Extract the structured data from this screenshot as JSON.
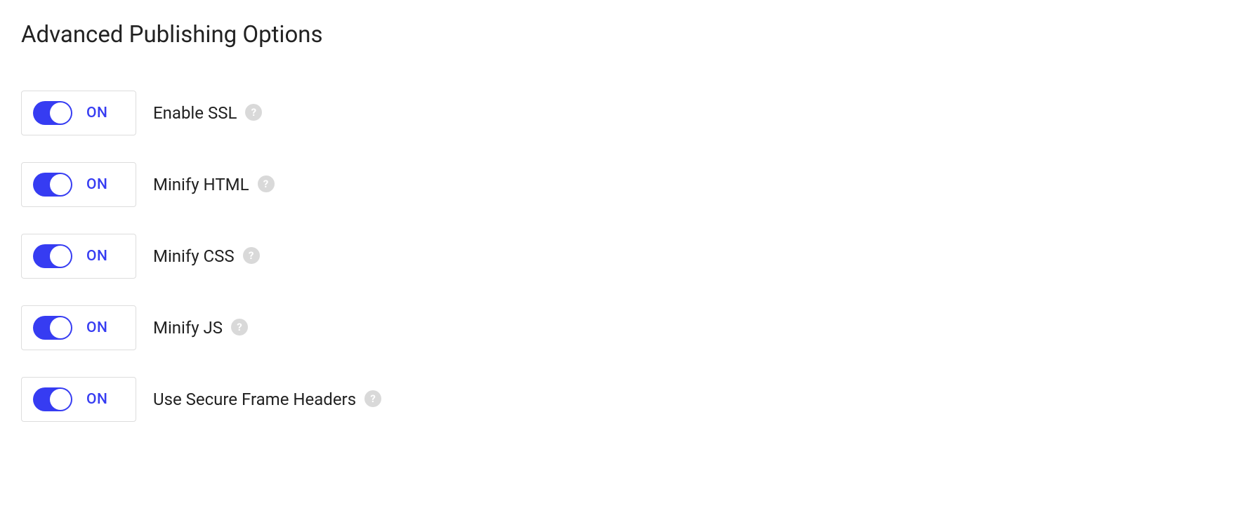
{
  "section": {
    "title": "Advanced Publishing Options"
  },
  "toggle": {
    "state_on": "ON"
  },
  "help": {
    "glyph": "?"
  },
  "options": [
    {
      "label": "Enable SSL"
    },
    {
      "label": "Minify HTML"
    },
    {
      "label": "Minify CSS"
    },
    {
      "label": "Minify JS"
    },
    {
      "label": "Use Secure Frame Headers"
    }
  ]
}
